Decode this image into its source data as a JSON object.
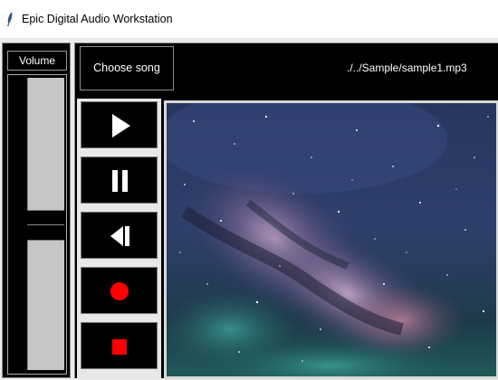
{
  "window": {
    "title": "Epic Digital Audio Workstation",
    "app_icon": "feather-icon"
  },
  "volume": {
    "label": "Volume",
    "level": 0.5
  },
  "song": {
    "choose_label": "Choose song",
    "file_path": "./../Sample/sample1.mp3"
  },
  "controls": [
    {
      "name": "play-button",
      "icon": "play-icon",
      "color": "#ffffff"
    },
    {
      "name": "pause-button",
      "icon": "pause-icon",
      "color": "#ffffff"
    },
    {
      "name": "previous-button",
      "icon": "skip-back-icon",
      "color": "#ffffff"
    },
    {
      "name": "record-button",
      "icon": "record-icon",
      "color": "#ff0000"
    },
    {
      "name": "stop-button",
      "icon": "stop-icon",
      "color": "#ff0000"
    }
  ],
  "colors": {
    "background": "#000000",
    "panel_border": "#d9d9d9",
    "accent_red": "#ff0000"
  }
}
